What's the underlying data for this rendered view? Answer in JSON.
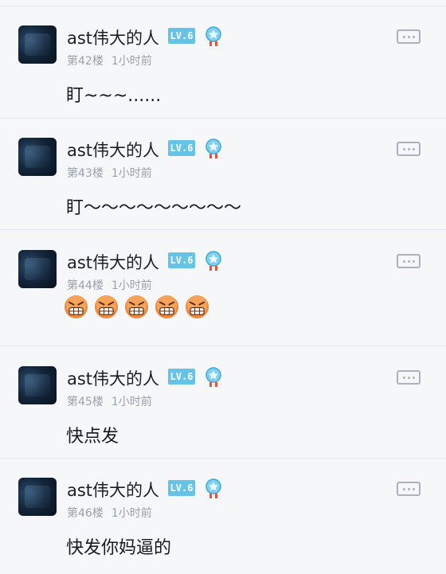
{
  "level_badge": "LV.6",
  "posts": [
    {
      "username": "ast伟大的人",
      "floor": "第42楼",
      "time": "1小时前",
      "content": "盯~~~......"
    },
    {
      "username": "ast伟大的人",
      "floor": "第43楼",
      "time": "1小时前",
      "content": "盯～～～～～～～～～"
    },
    {
      "username": "ast伟大的人",
      "floor": "第44楼",
      "time": "1小时前",
      "emoji_count": 5,
      "emoji_name": "grinning-angry-emoji"
    },
    {
      "username": "ast伟大的人",
      "floor": "第45楼",
      "time": "1小时前",
      "content": "快点发"
    },
    {
      "username": "ast伟大的人",
      "floor": "第46楼",
      "time": "1小时前",
      "content": "快发你妈逼的"
    }
  ],
  "colors": {
    "accent": "#66c3e8",
    "meta": "#9aa0a8",
    "divider": "#dfe6ee"
  }
}
